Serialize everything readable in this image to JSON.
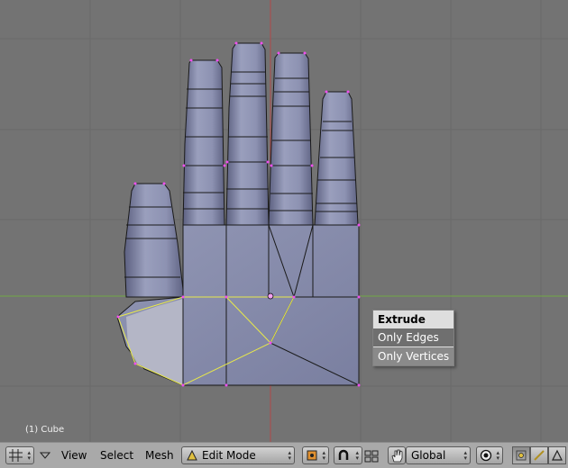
{
  "viewport": {
    "object_label": "(1) Cube"
  },
  "popup": {
    "title": "Extrude",
    "items": [
      "Only Edges",
      "Only Vertices"
    ]
  },
  "header": {
    "menus": [
      "View",
      "Select",
      "Mesh"
    ],
    "mode": "Edit Mode",
    "orientation": "Global",
    "icons": [
      "editor-type-icon",
      "menu-collapse-icon",
      "mode-icon",
      "pivot-icon",
      "magnet-icon",
      "manipulator-icon",
      "hand-icon",
      "proportional-icon",
      "vertex-select-icon",
      "edge-select-icon",
      "face-select-icon"
    ]
  },
  "colors": {
    "background": "#737373",
    "x_axis": "#72a845",
    "y_axis": "#b04a4a",
    "selected_edge": "#e8e84a",
    "vertex": "#f04ff0",
    "mesh_face": "#8a8fae"
  }
}
